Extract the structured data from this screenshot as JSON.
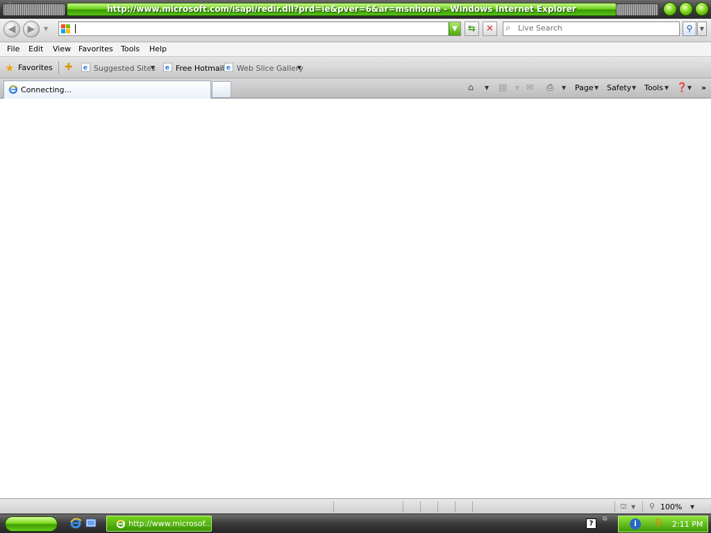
{
  "window": {
    "title": "http://www.microsoft.com/isapi/redir.dll?prd=ie&pver=6&ar=msnhome - Windows Internet Explorer"
  },
  "address_bar": {
    "value": "",
    "search_placeholder": "Live Search"
  },
  "menu": {
    "items": [
      "File",
      "Edit",
      "View",
      "Favorites",
      "Tools",
      "Help"
    ]
  },
  "favorites_bar": {
    "favorites_label": "Favorites",
    "links": [
      "Suggested Sites",
      "Free Hotmail",
      "Web Slice Gallery"
    ]
  },
  "tabs": {
    "active_title": "Connecting..."
  },
  "command_bar": {
    "page_label": "Page",
    "safety_label": "Safety",
    "tools_label": "Tools",
    "more": "»"
  },
  "status_bar": {
    "zoom": "100%"
  },
  "taskbar": {
    "task_title": "http://www.microsof...",
    "clock": "2:11 PM"
  },
  "colors": {
    "accent_green": "#6ed41c",
    "chrome_gray": "#d4d4d4"
  }
}
